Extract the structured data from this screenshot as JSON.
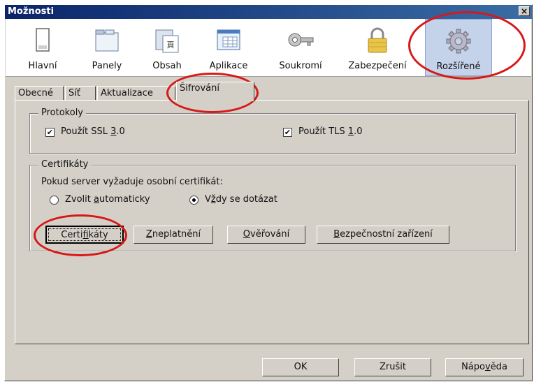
{
  "window": {
    "title": "Možnosti",
    "close_label": "×"
  },
  "toolbar": {
    "items": [
      {
        "label": "Hlavní",
        "icon": "window-icon"
      },
      {
        "label": "Panely",
        "icon": "tabs-icon"
      },
      {
        "label": "Obsah",
        "icon": "content-icon"
      },
      {
        "label": "Aplikace",
        "icon": "applications-icon"
      },
      {
        "label": "Soukromí",
        "icon": "key-icon"
      },
      {
        "label": "Zabezpečení",
        "icon": "lock-icon"
      },
      {
        "label": "Rozšířené",
        "icon": "gear-icon",
        "selected": true
      }
    ]
  },
  "tabs": [
    {
      "label": "Obecné"
    },
    {
      "label": "Síť"
    },
    {
      "label": "Aktualizace"
    },
    {
      "label": "Šifrování",
      "active": true
    }
  ],
  "protocols": {
    "title": "Protokoly",
    "ssl": {
      "pre": "Použít SSL ",
      "mn": "3",
      "post": ".0",
      "checked": true
    },
    "tls": {
      "pre": "Použít TLS ",
      "mn": "1",
      "post": ".0",
      "checked": true
    }
  },
  "certificates": {
    "title": "Certifikáty",
    "prompt": "Pokud server vyžaduje osobní certifikát:",
    "auto": {
      "pre": "Zvolit ",
      "mn": "a",
      "post": "utomaticky",
      "checked": false
    },
    "ask": {
      "pre": "V",
      "mn": "ž",
      "post": "dy se dotázat",
      "checked": true
    },
    "buttons": {
      "certs": {
        "pre": "Certi",
        "mn": "f",
        "post": "ikáty"
      },
      "revoke": {
        "pre": "",
        "mn": "Z",
        "post": "neplatnění"
      },
      "verify": {
        "pre": "",
        "mn": "O",
        "post": "věřování"
      },
      "devices": {
        "pre": "",
        "mn": "B",
        "post": "ezpečnostní zařízení"
      }
    }
  },
  "footer": {
    "ok": "OK",
    "cancel": "Zrušit",
    "help": {
      "pre": "Nápo",
      "mn": "v",
      "post": "ěda"
    }
  },
  "colors": {
    "annotation": "#d81818",
    "titlebar": "#0a246a",
    "selected_bg": "#c5d3ea"
  }
}
